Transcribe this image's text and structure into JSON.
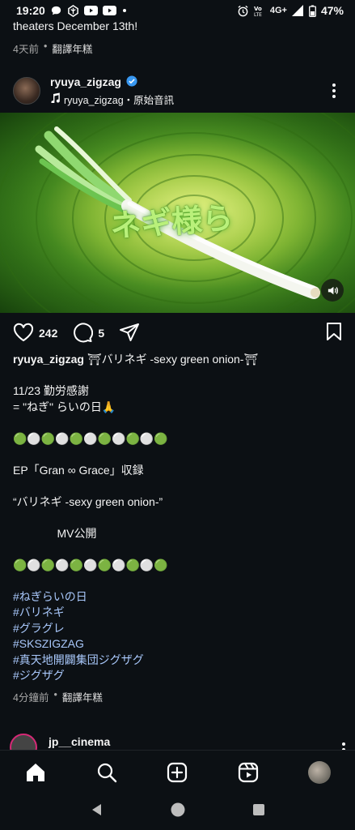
{
  "status_bar": {
    "time": "19:20",
    "network": "4G+",
    "battery": "47%"
  },
  "previous_post": {
    "caption_tail": "theaters December 13th!",
    "time_ago": "4天前",
    "translate": "翻譯年糕"
  },
  "post": {
    "username": "ryuya_zigzag",
    "verified": true,
    "audio": "ryuya_zigzag・原始音訊",
    "media": {
      "overlay_text": "ネギ様ら",
      "colors": {
        "bg_light": "#d8e86a",
        "bg_dark": "#17420c"
      }
    },
    "likes": "242",
    "comments": "5",
    "caption_lines": [
      {
        "text": "ryuya_zigzag ⛩バリネギ -sexy green onion-⛩",
        "type": "head"
      },
      {
        "text": "",
        "type": "blank"
      },
      {
        "text": "11/23 勤労感謝",
        "type": "text"
      },
      {
        "text": "= \"ねぎ\" らいの日🙏",
        "type": "text"
      },
      {
        "text": "",
        "type": "blank"
      },
      {
        "text": "🟢⚪🟢⚪🟢⚪🟢⚪🟢⚪🟢",
        "type": "text"
      },
      {
        "text": "",
        "type": "blank"
      },
      {
        "text": "EP「Gran ∞ Grace」収録",
        "type": "text"
      },
      {
        "text": "",
        "type": "blank"
      },
      {
        "text": "“バリネギ -sexy green onion-”",
        "type": "text"
      },
      {
        "text": "",
        "type": "blank"
      },
      {
        "text": "              MV公開",
        "type": "text"
      },
      {
        "text": "",
        "type": "blank"
      },
      {
        "text": "🟢⚪🟢⚪🟢⚪🟢⚪🟢⚪🟢",
        "type": "text"
      },
      {
        "text": "",
        "type": "blank"
      },
      {
        "text": "#ねぎらいの日",
        "type": "tag"
      },
      {
        "text": "#バリネギ",
        "type": "tag"
      },
      {
        "text": "#グラグレ",
        "type": "tag"
      },
      {
        "text": "#SKSZIGZAG",
        "type": "tag"
      },
      {
        "text": "#真天地開闢集団ジグザグ",
        "type": "tag"
      },
      {
        "text": "#ジグザグ",
        "type": "tag"
      }
    ],
    "time_ago": "4分鐘前",
    "translate": "翻譯年糕"
  },
  "next_post": {
    "username": "jp__cinema"
  },
  "tabs": [
    "home-icon",
    "search-icon",
    "create-icon",
    "reels-icon",
    "profile-avatar"
  ],
  "accent": "#a8c7fa"
}
